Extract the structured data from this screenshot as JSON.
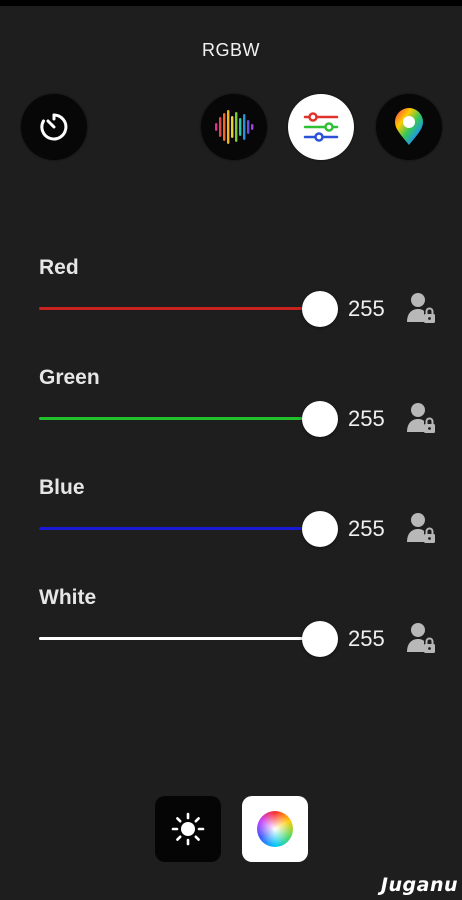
{
  "header": {
    "title": "RGBW"
  },
  "mode_buttons": {
    "timer": {
      "icon": "timer-icon"
    },
    "music": {
      "icon": "music-equalizer-icon"
    },
    "sliders": {
      "icon": "sliders-icon",
      "active": true
    },
    "palette": {
      "icon": "color-pin-icon"
    }
  },
  "channels": [
    {
      "label": "Red",
      "value": "255",
      "level": 1.0,
      "color": "#c8231e"
    },
    {
      "label": "Green",
      "value": "255",
      "level": 1.0,
      "color": "#22c02a"
    },
    {
      "label": "Blue",
      "value": "255",
      "level": 1.0,
      "color": "#1a1ad6"
    },
    {
      "label": "White",
      "value": "255",
      "level": 1.0,
      "color": "#ffffff"
    }
  ],
  "bottom_nav": {
    "brightness": {
      "icon": "brightness-icon"
    },
    "color_wheel": {
      "icon": "color-wheel-icon",
      "active": true
    }
  },
  "brand": {
    "name": "Juganu"
  }
}
